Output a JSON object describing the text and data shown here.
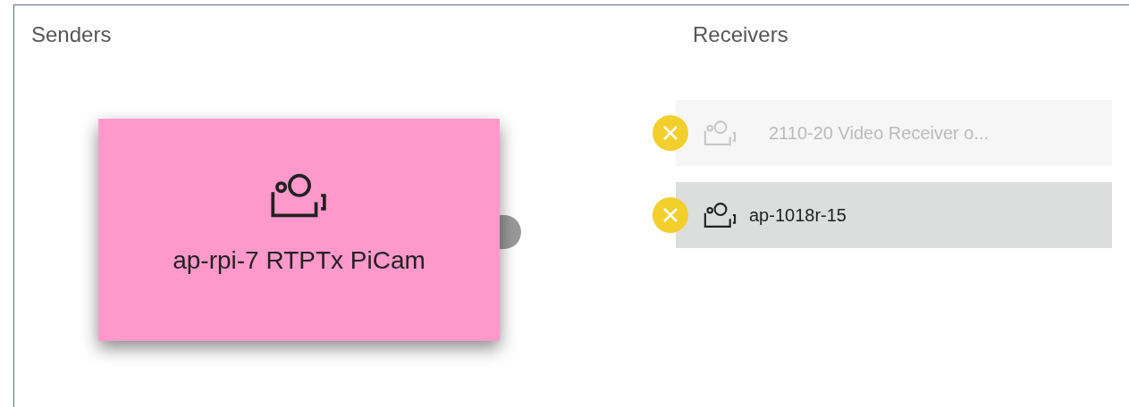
{
  "senders": {
    "title": "Senders",
    "items": [
      {
        "label": "ap-rpi-7 RTPTx PiCam"
      }
    ]
  },
  "receivers": {
    "title": "Receivers",
    "items": [
      {
        "label": "2110-20 Video Receiver o...",
        "disabled": true
      },
      {
        "label": "ap-1018r-15",
        "disabled": false
      }
    ]
  }
}
